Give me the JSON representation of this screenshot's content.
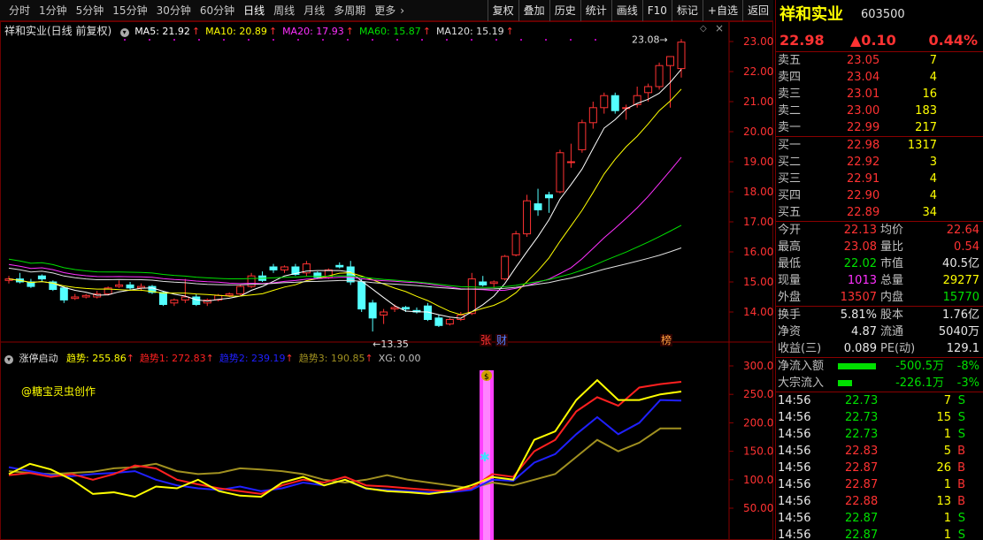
{
  "toolbar": {
    "periods": [
      "分时",
      "1分钟",
      "5分钟",
      "15分钟",
      "30分钟",
      "60分钟",
      "日线",
      "周线",
      "月线",
      "多周期",
      "更多"
    ],
    "active_period": "日线",
    "functions": [
      "复权",
      "叠加",
      "历史",
      "统计",
      "画线",
      "F10",
      "标记",
      "+自选",
      "返回"
    ]
  },
  "chart": {
    "title": "祥和实业(日线 前复权)",
    "ma": [
      {
        "label": "MA5: 21.92",
        "color": "#ffffff"
      },
      {
        "label": "MA10: 20.89",
        "color": "#ffff00"
      },
      {
        "label": "MA20: 17.93",
        "color": "#ff30ff"
      },
      {
        "label": "MA60: 15.87",
        "color": "#00e000"
      },
      {
        "label": "MA120: 15.19",
        "color": "#e0e0e0"
      }
    ],
    "y_ticks": [
      "23.00",
      "22.00",
      "21.00",
      "20.00",
      "19.00",
      "18.00",
      "17.00",
      "16.00",
      "15.00",
      "14.00"
    ],
    "high_note": "23.08",
    "low_note": "13.35",
    "badges": [
      "张",
      "财",
      "榜"
    ]
  },
  "indicator": {
    "title": "涨停启动",
    "lines": [
      {
        "label": "趋势: 255.86",
        "color": "#ffff00"
      },
      {
        "label": "趋势1: 272.83",
        "color": "#ff2020"
      },
      {
        "label": "趋势2: 239.19",
        "color": "#2020ff"
      },
      {
        "label": "趋势3: 190.85",
        "color": "#a09020"
      },
      {
        "label": "XG: 0.00",
        "color": "#c0c0c0"
      }
    ],
    "author_note": "@糖宝灵虫创作",
    "y_ticks": [
      "300.00",
      "250.00",
      "200.00",
      "150.00",
      "100.00",
      "50.00"
    ]
  },
  "stock": {
    "name": "祥和实业",
    "code": "603500",
    "price": "22.98",
    "change": "▲0.10",
    "pct": "0.44%"
  },
  "order_book": {
    "asks": [
      {
        "label": "卖五",
        "price": "23.05",
        "vol": "7"
      },
      {
        "label": "卖四",
        "price": "23.04",
        "vol": "4"
      },
      {
        "label": "卖三",
        "price": "23.01",
        "vol": "16"
      },
      {
        "label": "卖二",
        "price": "23.00",
        "vol": "183"
      },
      {
        "label": "卖一",
        "price": "22.99",
        "vol": "217"
      }
    ],
    "bids": [
      {
        "label": "买一",
        "price": "22.98",
        "vol": "1317"
      },
      {
        "label": "买二",
        "price": "22.92",
        "vol": "3"
      },
      {
        "label": "买三",
        "price": "22.91",
        "vol": "4"
      },
      {
        "label": "买四",
        "price": "22.90",
        "vol": "4"
      },
      {
        "label": "买五",
        "price": "22.89",
        "vol": "34"
      }
    ]
  },
  "stats": [
    {
      "l1": "今开",
      "v1": "22.13",
      "l2": "均价",
      "v2": "22.64"
    },
    {
      "l1": "最高",
      "v1": "23.08",
      "l2": "量比",
      "v2": "0.54"
    },
    {
      "l1": "最低",
      "v1": "22.02",
      "l2": "市值",
      "v2": "40.5亿"
    },
    {
      "l1": "现量",
      "v1": "1013",
      "l2": "总量",
      "v2": "29277"
    },
    {
      "l1": "外盘",
      "v1": "13507",
      "l2": "内盘",
      "v2": "15770"
    }
  ],
  "stats2": [
    {
      "l1": "换手",
      "v1": "5.81%",
      "l2": "股本",
      "v2": "1.76亿"
    },
    {
      "l1": "净资",
      "v1": "4.87",
      "l2": "流通",
      "v2": "5040万"
    },
    {
      "l1": "收益(三)",
      "v1": "0.089",
      "l2": "PE(动)",
      "v2": "129.1"
    }
  ],
  "flows": [
    {
      "label": "净流入额",
      "value": "-500.5万",
      "pct": "-8%",
      "bar": 0.8
    },
    {
      "label": "大宗流入",
      "value": "-226.1万",
      "pct": "-3%",
      "bar": 0.3
    }
  ],
  "ticks": [
    {
      "time": "14:56",
      "price": "22.73",
      "vol": "7",
      "side": "S"
    },
    {
      "time": "14:56",
      "price": "22.73",
      "vol": "15",
      "side": "S"
    },
    {
      "time": "14:56",
      "price": "22.73",
      "vol": "1",
      "side": "S"
    },
    {
      "time": "14:56",
      "price": "22.83",
      "vol": "5",
      "side": "B"
    },
    {
      "time": "14:56",
      "price": "22.87",
      "vol": "26",
      "side": "B"
    },
    {
      "time": "14:56",
      "price": "22.87",
      "vol": "1",
      "side": "B"
    },
    {
      "time": "14:56",
      "price": "22.88",
      "vol": "13",
      "side": "B"
    },
    {
      "time": "14:56",
      "price": "22.87",
      "vol": "1",
      "side": "S"
    },
    {
      "time": "14:56",
      "price": "22.87",
      "vol": "1",
      "side": "S"
    }
  ],
  "colors": {
    "up": "#ff3232",
    "down": "#00e000",
    "frame": "#8a0000",
    "cyan_candle": "#54ffff",
    "indicator_bar": "#ff40ff"
  }
}
